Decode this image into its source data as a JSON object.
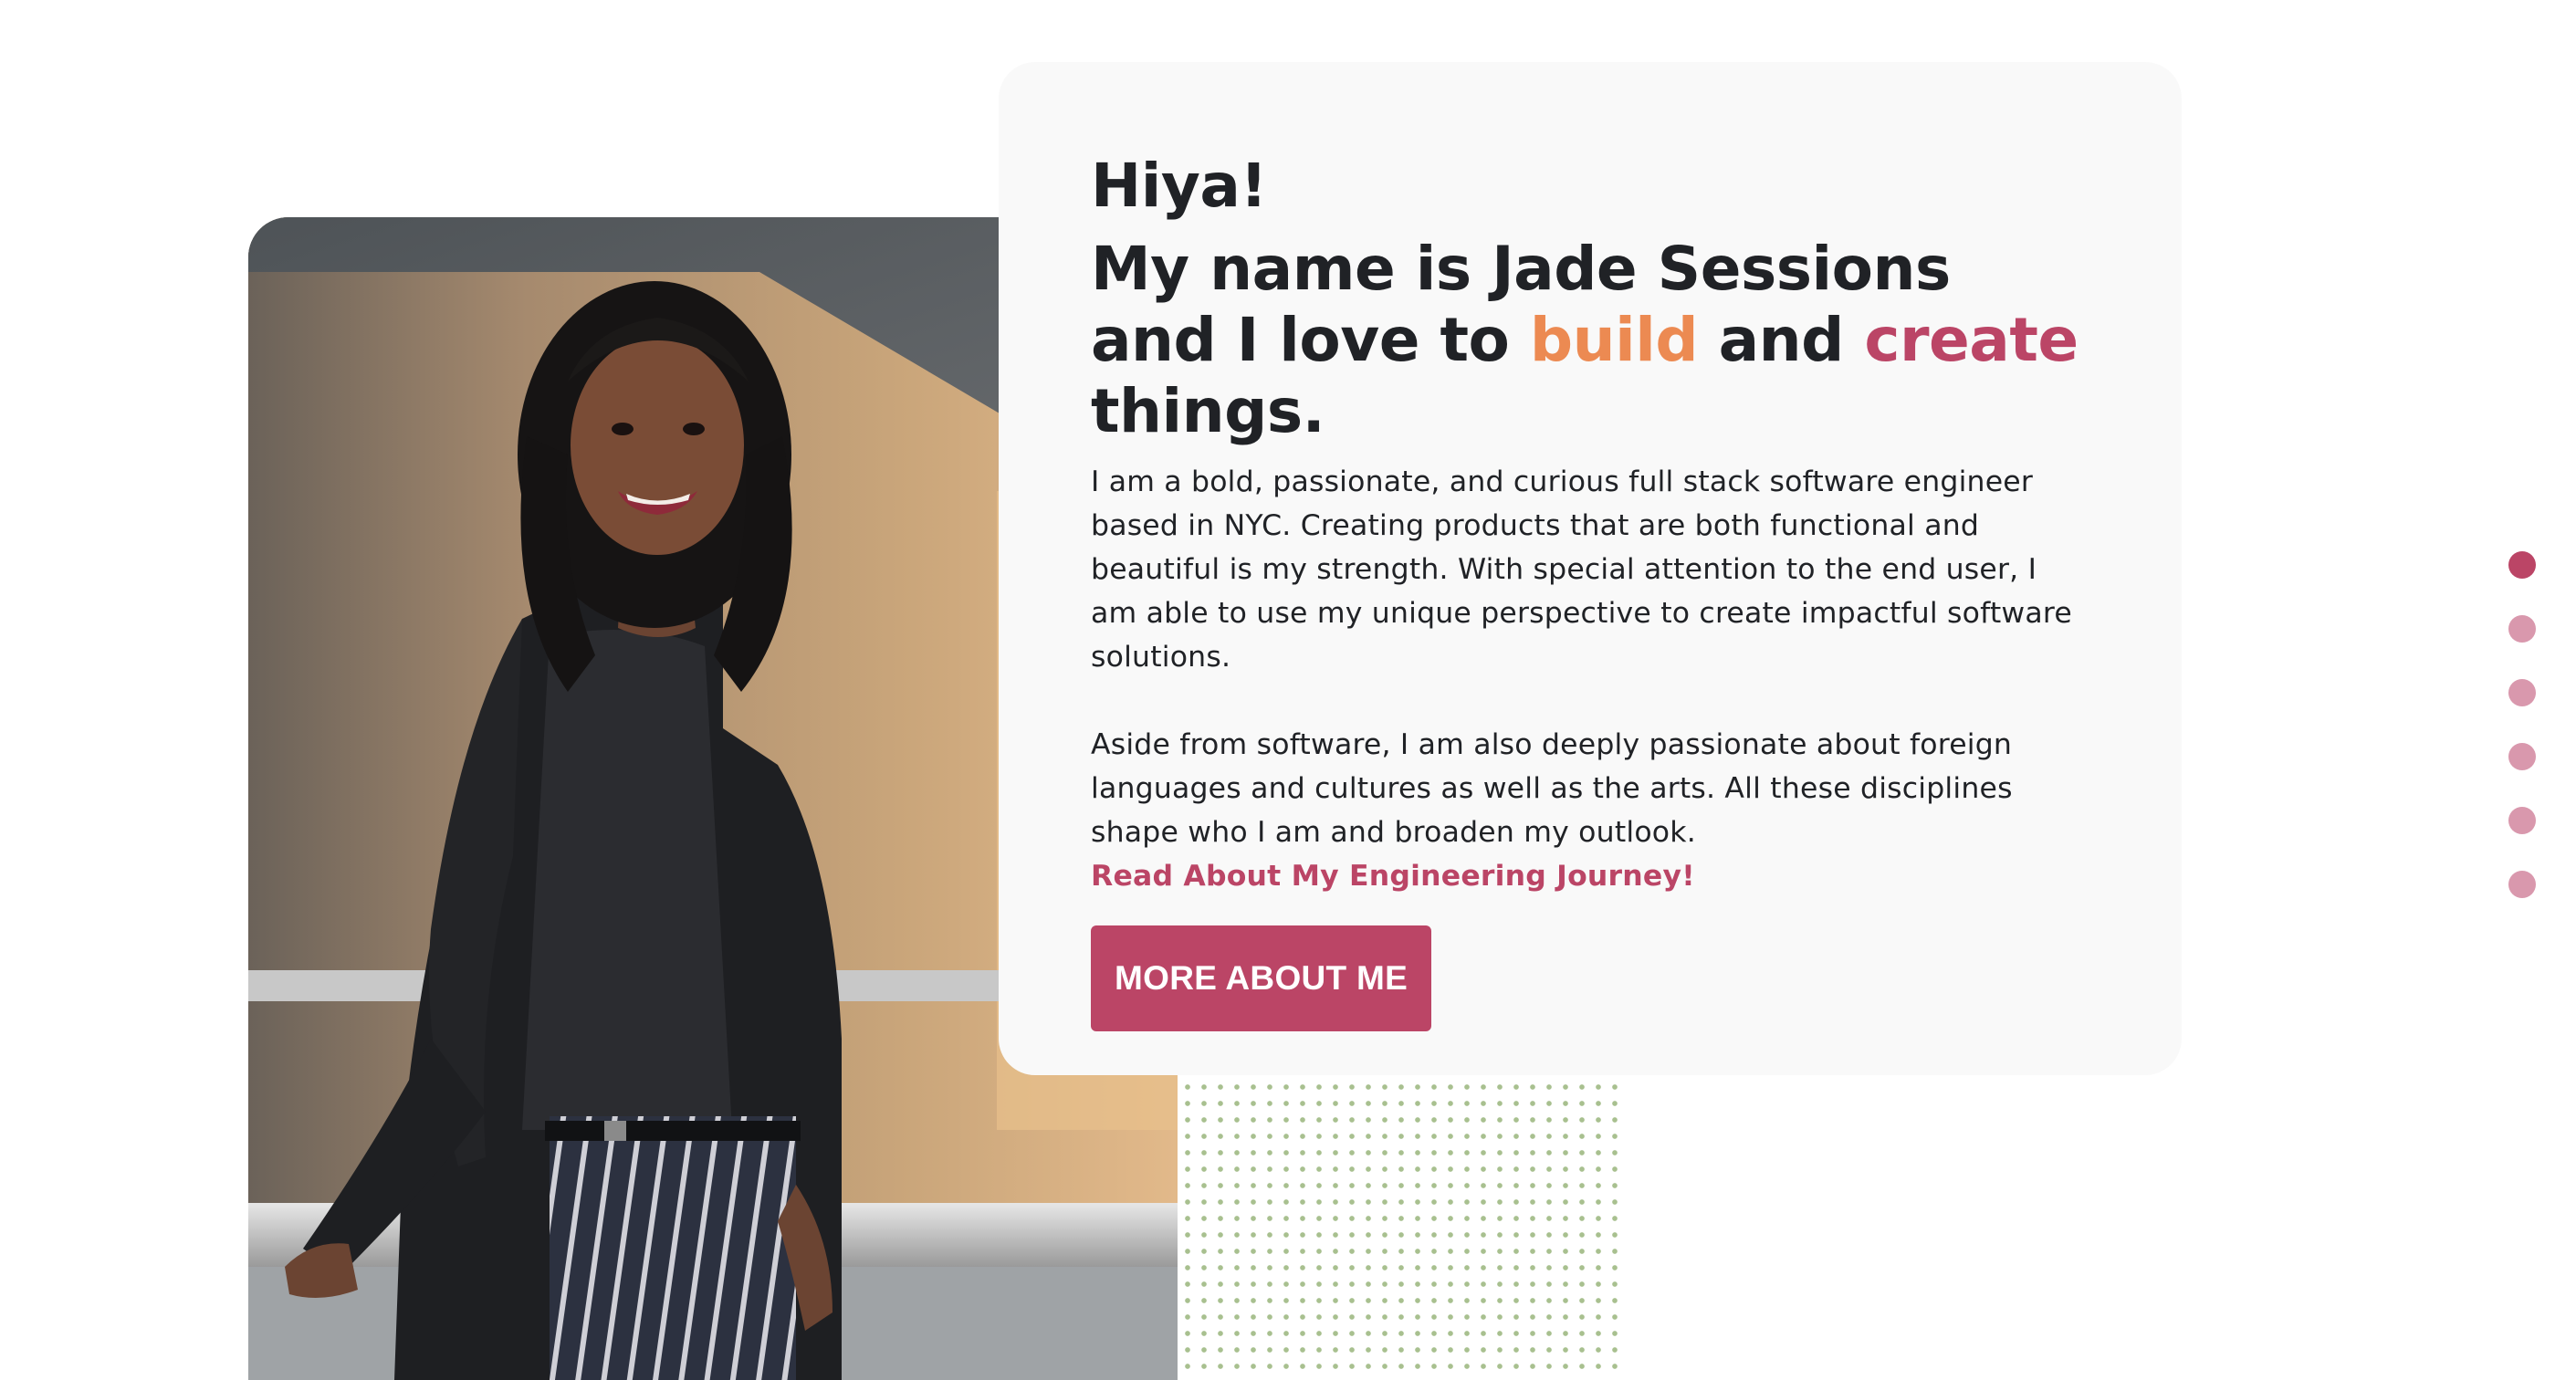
{
  "intro": {
    "greeting": "Hiya!",
    "headline_part1": "My name is Jade Sessions and I love to",
    "headline_build": "build",
    "headline_and": "and",
    "headline_create": "create",
    "headline_end": "things.",
    "paragraph1": "I am a bold, passionate, and curious full stack software engineer based in NYC. Creating products that are both functional and beautiful is my strength. With special attention to the end user, I am able to use my unique perspective to create impactful software solutions.",
    "paragraph2": "Aside from software, I am also deeply passionate about foreign languages and cultures as well as the arts. All these disciplines shape who I am and broaden my outlook.",
    "journey_link": "Read About My Engineering Journey!",
    "more_button": "MORE ABOUT ME"
  },
  "pager": {
    "count": 6,
    "active_index": 0
  },
  "colors": {
    "accent_pink": "#bb4566",
    "accent_orange": "#ec8a52",
    "pager_inactive": "#d998ad",
    "card_bg": "#f9f9f9",
    "dot_pattern": "#a8c08f"
  }
}
